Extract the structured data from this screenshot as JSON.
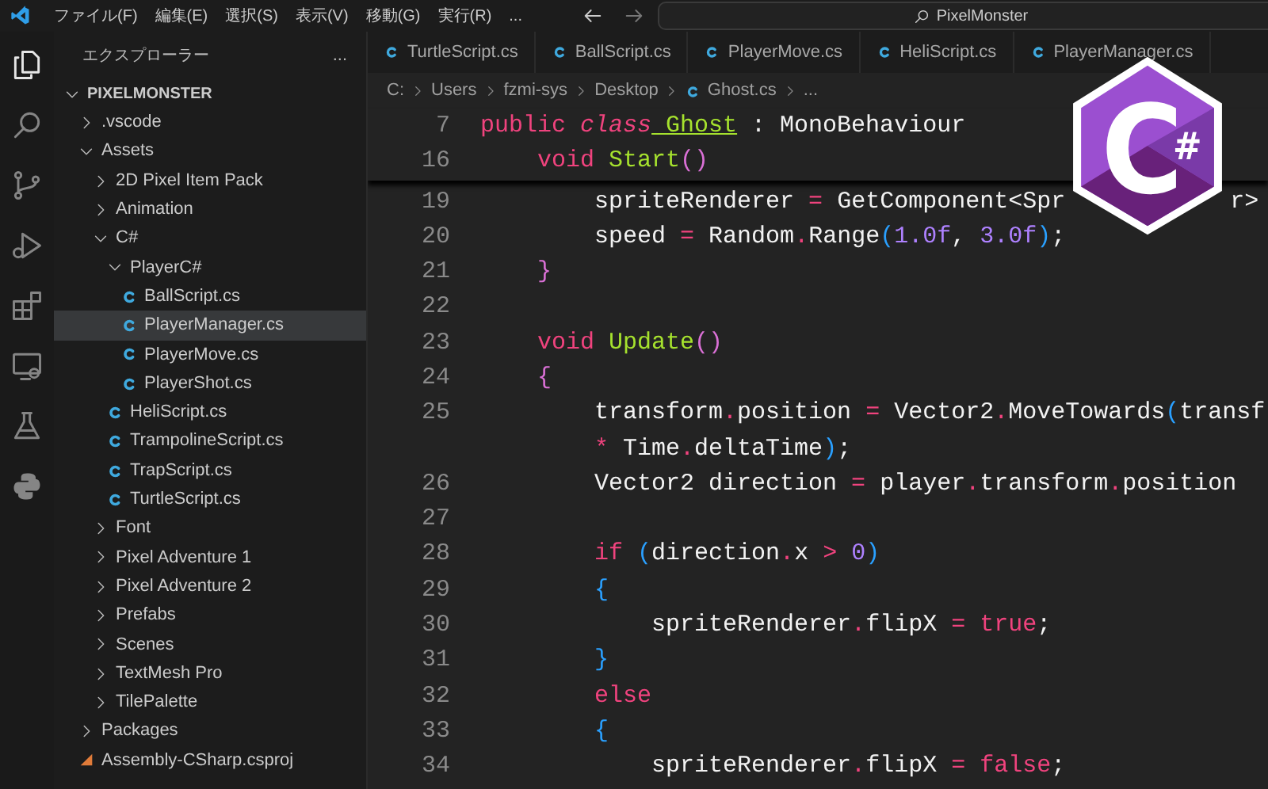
{
  "menu": [
    "ファイル(F)",
    "編集(E)",
    "選択(S)",
    "表示(V)",
    "移動(G)",
    "実行(R)",
    "..."
  ],
  "search": {
    "value": "PixelMonster"
  },
  "activity_bar": [
    {
      "kind": "files",
      "selected": true
    },
    {
      "kind": "search",
      "selected": false
    },
    {
      "kind": "branch",
      "selected": false
    },
    {
      "kind": "run",
      "selected": false
    },
    {
      "kind": "extensions",
      "selected": false
    },
    {
      "kind": "remote",
      "selected": false
    },
    {
      "kind": "flask",
      "selected": false
    },
    {
      "kind": "snake",
      "selected": false
    }
  ],
  "sidebar": {
    "title": "エクスプローラー",
    "more": "...",
    "tree": [
      {
        "label": "PIXELMONSTER",
        "kind": "folder",
        "expanded": true,
        "children": [
          {
            "label": ".vscode",
            "kind": "folder",
            "expanded": false
          },
          {
            "label": "Assets",
            "kind": "folder",
            "expanded": true,
            "children": [
              {
                "label": "2D Pixel Item Pack",
                "kind": "folder",
                "expanded": false
              },
              {
                "label": "Animation",
                "kind": "folder",
                "expanded": false
              },
              {
                "label": "C#",
                "kind": "folder",
                "expanded": true,
                "children": [
                  {
                    "label": "PlayerC#",
                    "kind": "folder",
                    "expanded": true,
                    "children": [
                      {
                        "label": "BallScript.cs",
                        "kind": "cs",
                        "selected": false
                      },
                      {
                        "label": "PlayerManager.cs",
                        "kind": "cs",
                        "selected": true
                      },
                      {
                        "label": "PlayerMove.cs",
                        "kind": "cs",
                        "selected": false
                      },
                      {
                        "label": "PlayerShot.cs",
                        "kind": "cs",
                        "selected": false
                      }
                    ]
                  },
                  {
                    "label": "HeliScript.cs",
                    "kind": "cs",
                    "selected": false
                  },
                  {
                    "label": "TrampolineScript.cs",
                    "kind": "cs",
                    "selected": false
                  },
                  {
                    "label": "TrapScript.cs",
                    "kind": "cs",
                    "selected": false
                  },
                  {
                    "label": "TurtleScript.cs",
                    "kind": "cs",
                    "selected": false
                  }
                ]
              },
              {
                "label": "Font",
                "kind": "folder",
                "expanded": false
              },
              {
                "label": "Pixel Adventure 1",
                "kind": "folder",
                "expanded": false
              },
              {
                "label": "Pixel Adventure 2",
                "kind": "folder",
                "expanded": false
              },
              {
                "label": "Prefabs",
                "kind": "folder",
                "expanded": false
              },
              {
                "label": "Scenes",
                "kind": "folder",
                "expanded": false
              },
              {
                "label": "TextMesh Pro",
                "kind": "folder",
                "expanded": false
              },
              {
                "label": "TilePalette",
                "kind": "folder",
                "expanded": false
              }
            ]
          },
          {
            "label": "Packages",
            "kind": "folder",
            "expanded": false
          },
          {
            "label": "Assembly-CSharp.csproj",
            "kind": "csproj",
            "selected": false
          }
        ]
      }
    ]
  },
  "tabs": [
    {
      "label": "TurtleScript.cs",
      "selected": false
    },
    {
      "label": "BallScript.cs",
      "selected": false
    },
    {
      "label": "PlayerMove.cs",
      "selected": false
    },
    {
      "label": "HeliScript.cs",
      "selected": false
    },
    {
      "label": "PlayerManager.cs",
      "selected": false
    }
  ],
  "breadcrumb": [
    {
      "label": "C:",
      "kind": "folder"
    },
    {
      "label": "Users",
      "kind": "folder"
    },
    {
      "label": "fzmi-sys",
      "kind": "folder"
    },
    {
      "label": "Desktop",
      "kind": "folder"
    },
    {
      "label": "Ghost.cs",
      "kind": "file"
    },
    {
      "label": "...",
      "kind": "folder"
    }
  ],
  "logo": {
    "letter": "C",
    "mark": "#"
  },
  "sticky_scroll": [
    {
      "number": "7",
      "tokens": [
        {
          "kind": "kw",
          "text": "public"
        },
        {
          "kind": "kwi",
          "text": " class"
        },
        {
          "kind": "decl",
          "text": " Ghost"
        },
        {
          "kind": "id",
          "text": " : MonoBehaviour"
        }
      ]
    },
    {
      "number": "16",
      "tokens": [
        {
          "kind": "kw",
          "text": "    void"
        },
        {
          "kind": "fn",
          "text": " Start"
        },
        {
          "kind": "b1",
          "text": "()"
        }
      ]
    }
  ],
  "code": [
    {
      "number": "19",
      "tokens": [
        {
          "kind": "id",
          "text": "        spriteRenderer"
        },
        {
          "kind": "op",
          "text": " = "
        },
        {
          "kind": "id",
          "text": "GetComponent<Spr"
        },
        {
          "kind": "covered"
        },
        {
          "kind": "id",
          "text": "r>"
        }
      ]
    },
    {
      "number": "20",
      "tokens": [
        {
          "kind": "id",
          "text": "        speed"
        },
        {
          "kind": "op",
          "text": " = "
        },
        {
          "kind": "id",
          "text": "Random"
        },
        {
          "kind": "op",
          "text": "."
        },
        {
          "kind": "id",
          "text": "Range"
        },
        {
          "kind": "b2",
          "text": "("
        },
        {
          "kind": "num",
          "text": "1.0f"
        },
        {
          "kind": "id",
          "text": ", "
        },
        {
          "kind": "num",
          "text": "3.0f"
        },
        {
          "kind": "b2",
          "text": ")"
        },
        {
          "kind": "id",
          "text": ";"
        }
      ]
    },
    {
      "number": "21",
      "tokens": [
        {
          "kind": "b1",
          "text": "    }"
        }
      ]
    },
    {
      "number": "22"
    },
    {
      "number": "23",
      "tokens": [
        {
          "kind": "kw",
          "text": "    void"
        },
        {
          "kind": "fn",
          "text": " Update"
        },
        {
          "kind": "b1",
          "text": "()"
        }
      ]
    },
    {
      "number": "24",
      "tokens": [
        {
          "kind": "b1",
          "text": "    {"
        }
      ]
    },
    {
      "number": "25",
      "tokens": [
        {
          "kind": "id",
          "text": "        transform"
        },
        {
          "kind": "op",
          "text": "."
        },
        {
          "kind": "id",
          "text": "position"
        },
        {
          "kind": "op",
          "text": " = "
        },
        {
          "kind": "id",
          "text": "Vector2"
        },
        {
          "kind": "op",
          "text": "."
        },
        {
          "kind": "id",
          "text": "MoveTowards"
        },
        {
          "kind": "b2",
          "text": "("
        },
        {
          "kind": "id",
          "text": "transf"
        }
      ]
    },
    {
      "tokens": [
        {
          "kind": "op",
          "text": "        *"
        },
        {
          "kind": "id",
          "text": " Time"
        },
        {
          "kind": "op",
          "text": "."
        },
        {
          "kind": "id",
          "text": "deltaTime"
        },
        {
          "kind": "b2",
          "text": ")"
        },
        {
          "kind": "id",
          "text": ";"
        }
      ]
    },
    {
      "number": "26",
      "tokens": [
        {
          "kind": "id",
          "text": "        Vector2 direction"
        },
        {
          "kind": "op",
          "text": " = "
        },
        {
          "kind": "id",
          "text": "player"
        },
        {
          "kind": "op",
          "text": "."
        },
        {
          "kind": "id",
          "text": "transform"
        },
        {
          "kind": "op",
          "text": "."
        },
        {
          "kind": "id",
          "text": "position"
        }
      ]
    },
    {
      "number": "27"
    },
    {
      "number": "28",
      "tokens": [
        {
          "kind": "kw",
          "text": "        if"
        },
        {
          "kind": "b2",
          "text": " ("
        },
        {
          "kind": "id",
          "text": "direction"
        },
        {
          "kind": "op",
          "text": "."
        },
        {
          "kind": "id",
          "text": "x"
        },
        {
          "kind": "op",
          "text": " > "
        },
        {
          "kind": "num",
          "text": "0"
        },
        {
          "kind": "b2",
          "text": ")"
        }
      ]
    },
    {
      "number": "29",
      "tokens": [
        {
          "kind": "b2",
          "text": "        {"
        }
      ]
    },
    {
      "number": "30",
      "tokens": [
        {
          "kind": "id",
          "text": "            spriteRenderer"
        },
        {
          "kind": "op",
          "text": "."
        },
        {
          "kind": "id",
          "text": "flipX"
        },
        {
          "kind": "op",
          "text": " = "
        },
        {
          "kind": "kw",
          "text": "true"
        },
        {
          "kind": "id",
          "text": ";"
        }
      ]
    },
    {
      "number": "31",
      "tokens": [
        {
          "kind": "b2",
          "text": "        }"
        }
      ]
    },
    {
      "number": "32",
      "tokens": [
        {
          "kind": "kw",
          "text": "        else"
        }
      ]
    },
    {
      "number": "33",
      "tokens": [
        {
          "kind": "b2",
          "text": "        {"
        }
      ]
    },
    {
      "number": "34",
      "tokens": [
        {
          "kind": "id",
          "text": "            spriteRenderer"
        },
        {
          "kind": "op",
          "text": "."
        },
        {
          "kind": "id",
          "text": "flipX"
        },
        {
          "kind": "op",
          "text": " = "
        },
        {
          "kind": "kw",
          "text": "false"
        },
        {
          "kind": "id",
          "text": ";"
        }
      ]
    }
  ]
}
